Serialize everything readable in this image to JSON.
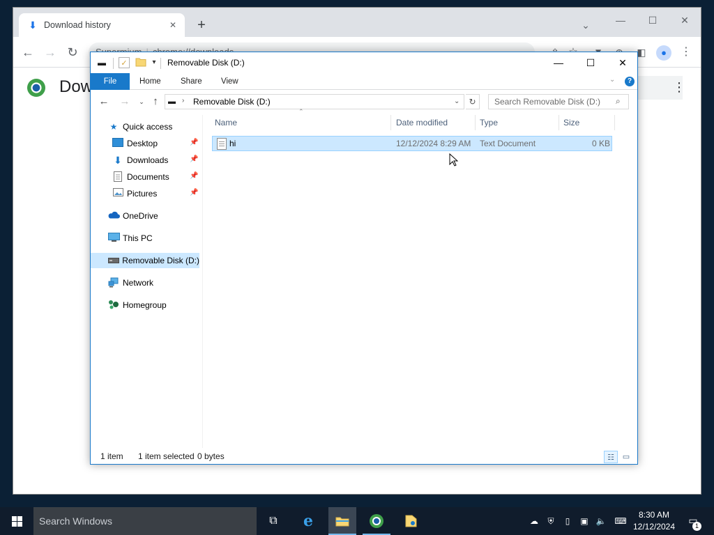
{
  "chrome": {
    "tab_title": "Download history",
    "omnibox_site": "Supermium",
    "omnibox_url": "chrome://downloads",
    "page_heading": "Dow",
    "icons": {
      "tab": "download-icon",
      "new_tab": "plus-icon",
      "back": "arrow-left-icon",
      "forward": "arrow-right-icon",
      "reload": "reload-icon",
      "share": "share-icon",
      "bookmark": "star-icon",
      "extensions": "puzzle-icon",
      "downloads": "download-icon",
      "side_panel": "side-panel-icon",
      "profile": "person-icon",
      "menu": "kebab-menu-icon"
    }
  },
  "explorer": {
    "window_title": "Removable Disk (D:)",
    "ribbon_tabs": [
      "File",
      "Home",
      "Share",
      "View"
    ],
    "address_path": "Removable Disk (D:)",
    "search_placeholder": "Search Removable Disk (D:)",
    "nav_pane": {
      "quick_access": "Quick access",
      "pinned": [
        "Desktop",
        "Downloads",
        "Documents",
        "Pictures"
      ],
      "onedrive": "OneDrive",
      "this_pc": "This PC",
      "removable": "Removable Disk (D:)",
      "network": "Network",
      "homegroup": "Homegroup"
    },
    "columns": {
      "name": "Name",
      "date": "Date modified",
      "type": "Type",
      "size": "Size"
    },
    "files": [
      {
        "name": "hi",
        "date": "12/12/2024 8:29 AM",
        "type": "Text Document",
        "size": "0 KB",
        "selected": true
      }
    ],
    "status": {
      "count": "1 item",
      "selection": "1 item selected",
      "bytes": "0 bytes"
    }
  },
  "taskbar": {
    "search_placeholder": "Search Windows",
    "time": "8:30 AM",
    "date": "12/12/2024",
    "notification_count": "1"
  },
  "colors": {
    "accent": "#1979ca",
    "selection": "#cce8ff",
    "taskbar": "#101c2c"
  }
}
